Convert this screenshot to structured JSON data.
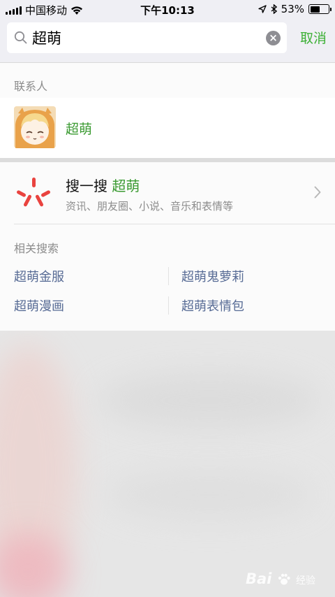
{
  "status_bar": {
    "carrier": "中国移动",
    "time": "下午10:13",
    "battery_percent": "53%",
    "battery_level": 0.53
  },
  "search": {
    "query": "超萌",
    "cancel_label": "取消",
    "clear_icon": "clear-icon"
  },
  "contacts": {
    "section_label": "联系人",
    "items": [
      {
        "name": "超萌"
      }
    ]
  },
  "sousou": {
    "title_prefix": "搜一搜",
    "title_keyword": "超萌",
    "description": "资讯、朋友圈、小说、音乐和表情等"
  },
  "related": {
    "section_label": "相关搜索",
    "items": [
      "超萌金服",
      "超萌鬼萝莉",
      "超萌漫画",
      "超萌表情包"
    ]
  },
  "watermark": {
    "brand": "Bai",
    "suffix": "经验"
  },
  "colors": {
    "accent_green": "#3cb035",
    "link_blue": "#576b95",
    "sousou_red": "#e9433f"
  }
}
